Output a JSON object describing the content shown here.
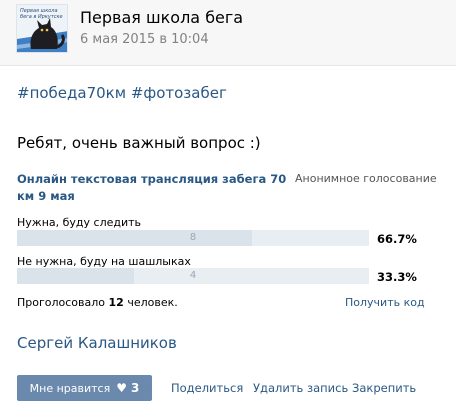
{
  "header": {
    "community_name": "Первая школа бега",
    "date": "6 мая 2015 в 10:04",
    "avatar_icon": "cat-logo-icon",
    "avatar_logo_text": "Первая школа бега в Иркутске"
  },
  "post": {
    "hashtags": "#победа70км #фотозабег",
    "text": "Ребят, очень важный вопрос :)",
    "signer": "Сергей Калашников"
  },
  "poll": {
    "title": "Онлайн текстовая трансляция забега 70 км 9 мая",
    "type_label": "Анонимное голосование",
    "options": [
      {
        "label": "Нужна, буду следить",
        "votes": "8",
        "percent": "66.7%",
        "fraction": 0.667
      },
      {
        "label": "Не нужна, буду на шашлыках",
        "votes": "4",
        "percent": "33.3%",
        "fraction": 0.333
      }
    ],
    "voted_prefix": "Проголосовало",
    "voted_count": "12",
    "voted_suffix": "человек.",
    "get_code": "Получить код"
  },
  "actions": {
    "like_label": "Мне нравится",
    "like_icon": "heart-icon",
    "like_count": "3",
    "share": "Поделиться",
    "delete": "Удалить запись",
    "pin": "Закрепить"
  },
  "colors": {
    "link": "#2a5885",
    "like_button": "#6a89ad",
    "bar_track": "#e9eef3"
  }
}
